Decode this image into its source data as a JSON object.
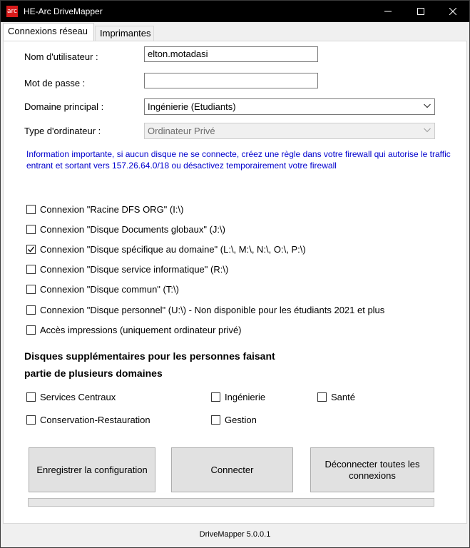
{
  "window": {
    "icon_text": "arc",
    "title": "HE-Arc DriveMapper",
    "buttons": {
      "minimize": "minimize-icon",
      "maximize": "maximize-icon",
      "close": "close-icon"
    }
  },
  "tabs": [
    {
      "label": "Connexions réseau",
      "active": true
    },
    {
      "label": "Imprimantes",
      "active": false
    }
  ],
  "form": {
    "username_label": "Nom d'utilisateur :",
    "username_value": "elton.motadasi",
    "password_label": "Mot de passe :",
    "password_value": "",
    "domain_label": "Domaine principal :",
    "domain_value": "Ingénierie (Etudiants)",
    "computer_type_label": "Type d'ordinateur :",
    "computer_type_value": "Ordinateur Privé"
  },
  "info_text": "Information importante, si aucun disque ne se connecte, créez une règle dans votre firewall qui autorise le traffic entrant et sortant vers 157.26.64.0/18 ou désactivez temporairement votre firewall",
  "drives": [
    {
      "label": "Connexion \"Racine DFS ORG\" (I:\\)",
      "checked": false
    },
    {
      "label": "Connexion \"Disque Documents globaux\" (J:\\)",
      "checked": false
    },
    {
      "label": "Connexion \"Disque spécifique au domaine\" (L:\\, M:\\, N:\\, O:\\, P:\\)",
      "checked": true
    },
    {
      "label": "Connexion \"Disque service informatique\" (R:\\)",
      "checked": false
    },
    {
      "label": "Connexion \"Disque commun\" (T:\\)",
      "checked": false
    },
    {
      "label": "Connexion \"Disque personnel\" (U:\\) - Non disponible pour les étudiants 2021 et plus",
      "checked": false
    },
    {
      "label": "Accès impressions (uniquement ordinateur privé)",
      "checked": false
    }
  ],
  "extra": {
    "heading_line1": "Disques supplémentaires pour les personnes faisant",
    "heading_line2": "partie de plusieurs domaines",
    "domains": [
      {
        "label": "Services Centraux",
        "checked": false
      },
      {
        "label": "Ingénierie",
        "checked": false
      },
      {
        "label": "Santé",
        "checked": false
      },
      {
        "label": "Conservation-Restauration",
        "checked": false
      },
      {
        "label": "Gestion",
        "checked": false
      }
    ]
  },
  "actions": {
    "save": "Enregistrer la configuration",
    "connect": "Connecter",
    "disconnect": "Déconnecter toutes les connexions"
  },
  "progress": {
    "value": 0
  },
  "status": "DriveMapper 5.0.0.1"
}
